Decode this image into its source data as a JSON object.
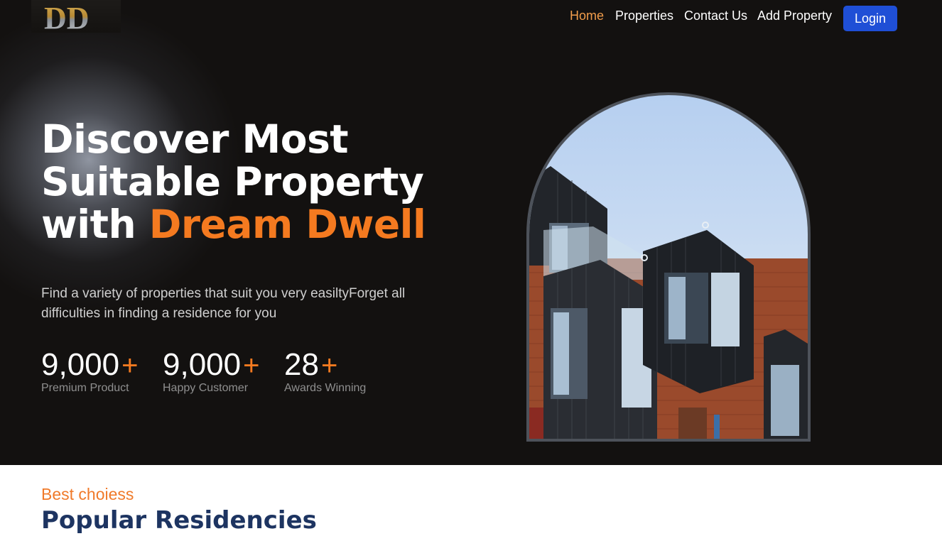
{
  "header": {
    "logo_text": "DD",
    "nav": [
      {
        "label": "Home",
        "active": true
      },
      {
        "label": "Properties",
        "active": false
      },
      {
        "label": "Contact Us",
        "active": false
      },
      {
        "label": "Add Property",
        "active": false
      }
    ],
    "login_label": "Login"
  },
  "hero": {
    "title_line1": "Discover Most",
    "title_line2": "Suitable Property",
    "title_line3_prefix": "with ",
    "title_accent": "Dream Dwell",
    "description": "Find a variety of properties that suit you very easiltyForget all difficulties in finding a residence for you",
    "stats": [
      {
        "value": "9,000",
        "plus": "+",
        "label": "Premium Product"
      },
      {
        "value": "9,000",
        "plus": "+",
        "label": "Happy Customer"
      },
      {
        "value": "28",
        "plus": "+",
        "label": "Awards Winning"
      }
    ],
    "image_icon": "building-photo"
  },
  "residencies": {
    "eyebrow": "Best choiess",
    "title": "Popular Residencies"
  },
  "colors": {
    "hero_bg": "#131110",
    "accent": "#f47a20",
    "nav_active": "#f29d4b",
    "login_bg": "#1f4fd6",
    "section_title": "#1d3461"
  }
}
